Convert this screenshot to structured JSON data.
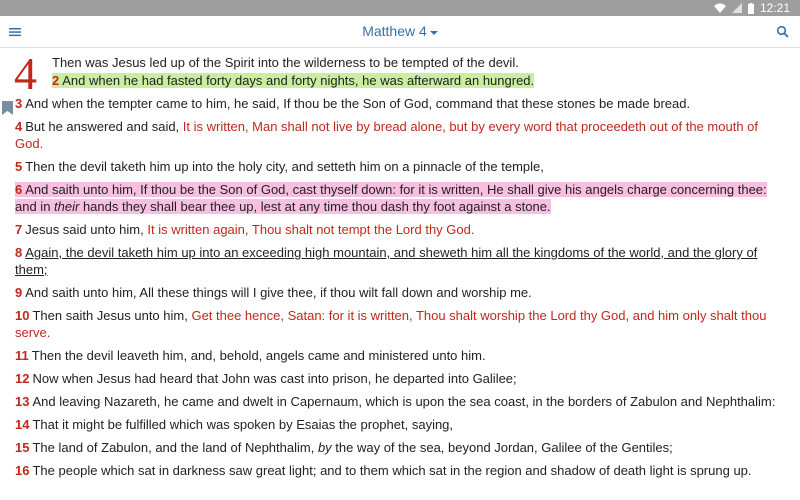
{
  "status_bar": {
    "time": "12:21"
  },
  "header": {
    "title": "Matthew 4"
  },
  "chapter": {
    "number": "4"
  },
  "verses": [
    {
      "num": "",
      "parts": [
        {
          "text": "Then was Jesus led up of the Spirit into the wilderness to be tempted of the devil.",
          "red": false
        }
      ]
    },
    {
      "num": "2",
      "highlight": "green",
      "parts": [
        {
          "text": "And when he had fasted forty days and forty nights, he was afterward an hungred.",
          "red": false
        }
      ]
    },
    {
      "num": "3",
      "bookmarked": true,
      "parts": [
        {
          "text": "And when the tempter came to him, he said, If thou be the Son of God, command that these stones be made bread.",
          "red": false
        }
      ]
    },
    {
      "num": "4",
      "parts": [
        {
          "text": "But he answered and said, ",
          "red": false
        },
        {
          "text": "It is written, Man shall not live by bread alone, but by every word that proceedeth out of the mouth of God.",
          "red": true
        }
      ]
    },
    {
      "num": "5",
      "parts": [
        {
          "text": "Then the devil taketh him up into the holy city, and setteth him on a pinnacle of the temple,",
          "red": false
        }
      ]
    },
    {
      "num": "6",
      "highlight": "pink",
      "parts": [
        {
          "text": "And saith unto him, If thou be the Son of God, cast thyself down: for it is written, He shall give his angels charge concerning thee: and in ",
          "red": false
        },
        {
          "text": "their",
          "red": false,
          "italic": true
        },
        {
          "text": " hands they shall bear thee up, lest at any time thou dash thy foot against a stone.",
          "red": false
        }
      ]
    },
    {
      "num": "7",
      "parts": [
        {
          "text": "Jesus said unto him, ",
          "red": false
        },
        {
          "text": "It is written again, Thou shalt not tempt the Lord thy God.",
          "red": true
        }
      ]
    },
    {
      "num": "8",
      "underline": true,
      "parts": [
        {
          "text": "Again, the devil taketh him up into an exceeding high mountain, and sheweth him all the kingdoms of the world, and the glory of them;",
          "red": false
        }
      ]
    },
    {
      "num": "9",
      "parts": [
        {
          "text": "And saith unto him, All these things will I give thee, if thou wilt fall down and worship me.",
          "red": false
        }
      ]
    },
    {
      "num": "10",
      "parts": [
        {
          "text": "Then saith Jesus unto him, ",
          "red": false
        },
        {
          "text": "Get thee hence, Satan: for it is written, Thou shalt worship the Lord thy God, and him only shalt thou serve.",
          "red": true
        }
      ]
    },
    {
      "num": "11",
      "parts": [
        {
          "text": "Then the devil leaveth him, and, behold, angels came and ministered unto him.",
          "red": false
        }
      ]
    },
    {
      "num": "12",
      "parts": [
        {
          "text": "Now when Jesus had heard that John was cast into prison, he departed into Galilee;",
          "red": false
        }
      ]
    },
    {
      "num": "13",
      "parts": [
        {
          "text": "And leaving Nazareth, he came and dwelt in Capernaum, which is upon the sea coast, in the borders of Zabulon and Nephthalim:",
          "red": false
        }
      ]
    },
    {
      "num": "14",
      "parts": [
        {
          "text": "That it might be fulfilled which was spoken by Esaias the prophet, saying,",
          "red": false
        }
      ]
    },
    {
      "num": "15",
      "parts": [
        {
          "text": "The land of Zabulon, and the land of Nephthalim, ",
          "red": false
        },
        {
          "text": "by",
          "red": false,
          "italic": true
        },
        {
          "text": " the way of the sea, beyond Jordan, Galilee of the Gentiles;",
          "red": false
        }
      ]
    },
    {
      "num": "16",
      "parts": [
        {
          "text": "The people which sat in darkness saw great light; and to them which sat in the region and shadow of death light is sprung up.",
          "red": false
        }
      ]
    }
  ],
  "icons": {
    "menu": "hamburger-menu-icon",
    "search": "search-icon",
    "dropdown": "caret-down-icon",
    "bookmark": "bookmark-icon",
    "wifi": "wifi-icon",
    "signal": "signal-icon",
    "battery": "battery-icon"
  },
  "colors": {
    "accent": "#3b6ea8",
    "red_letter": "#c0281b",
    "highlight_green": "#c9eea2",
    "highlight_pink": "#f8bfe2",
    "status_bar": "#9e9e9e"
  }
}
